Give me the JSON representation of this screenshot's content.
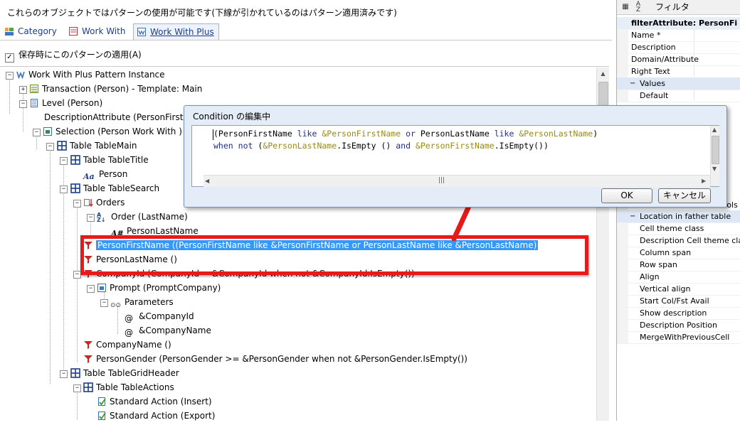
{
  "top_message": "これらのオブジェクトではパターンの使用が可能です(下線が引かれているのはパターン適用済みです)",
  "tabs": [
    {
      "label": "Category",
      "icon": "category-icon"
    },
    {
      "label": "Work With",
      "icon": "work-with-icon"
    },
    {
      "label": "Work With Plus",
      "icon": "work-with-plus-icon"
    }
  ],
  "apply_on_save": {
    "label": "保存時にこのパターンの適用(A)",
    "checked": true
  },
  "tree": {
    "root": "Work With Plus Pattern Instance",
    "transaction": "Transaction (Person) - Template: Main",
    "level": "Level (Person)",
    "description_attr": "DescriptionAttribute (PersonFirstN",
    "selection": "Selection (Person Work With )",
    "table_main": "Table TableMain",
    "table_title": "Table TableTitle",
    "person": "Person",
    "table_search": "Table TableSearch",
    "orders": "Orders",
    "order": "Order (LastName)",
    "order_attr": "PersonLastName",
    "filter_first": "PersonFirstName ((PersonFirstName like &PersonFirstName or PersonLastName like &PersonLastName)",
    "filter_last": "PersonLastName ()",
    "filter_company": "CompanyId (CompanyId = &CompanyId when not &CompanyId.IsEmpty())",
    "prompt": "Prompt (PromptCompany)",
    "parameters": "Parameters",
    "param1": "&CompanyId",
    "param2": "&CompanyName",
    "filter_companyname": "CompanyName ()",
    "filter_gender": "PersonGender (PersonGender >= &PersonGender when not &PersonGender.IsEmpty())",
    "table_grid_header": "Table TableGridHeader",
    "table_actions": "Table TableActions",
    "action_insert": "Standard Action (Insert)",
    "action_export": "Standard Action (Export)",
    "at_symbol": "@"
  },
  "properties": {
    "filter_label": "フィルタ",
    "header": "filterAttribute: PersonFirstN",
    "rows_top": [
      "Name *",
      "Description",
      "Domain/Attribute",
      "Right Text"
    ],
    "values_label": "Values",
    "default_label": "Default",
    "partial_ui": "rols",
    "location_label": "Location in father table",
    "rows_bottom": [
      "Cell theme class",
      "Description Cell theme class",
      "Column span",
      "Row span",
      "Align",
      "Vertical align",
      "Start Col/Fst Avail",
      "Show description",
      "Description Position",
      "MergeWithPreviousCell"
    ]
  },
  "dialog": {
    "title": "Condition の編集中",
    "line1": {
      "p1": "(PersonFirstName ",
      "k1": "like",
      "p2": " ",
      "v1": "&PersonFirstName",
      "p3": " ",
      "k2": "or",
      "p4": " PersonLastName ",
      "k3": "like",
      "p5": " ",
      "v2": "&PersonLastName",
      "p6": ")"
    },
    "line2": {
      "k1": "when",
      "p1": " ",
      "k2": "not",
      "p2": " (",
      "v1": "&PersonLastName",
      "p3": ".IsEmpty () ",
      "k3": "and",
      "p4": " ",
      "v2": "&PersonFirstName",
      "p5": ".IsEmpty())"
    },
    "ok": "OK",
    "cancel": "キャンセル"
  },
  "colors": {
    "highlight": "#e81919",
    "selection": "#3399ff",
    "keyword": "#1f2f8a",
    "variable": "#9b8a14"
  }
}
